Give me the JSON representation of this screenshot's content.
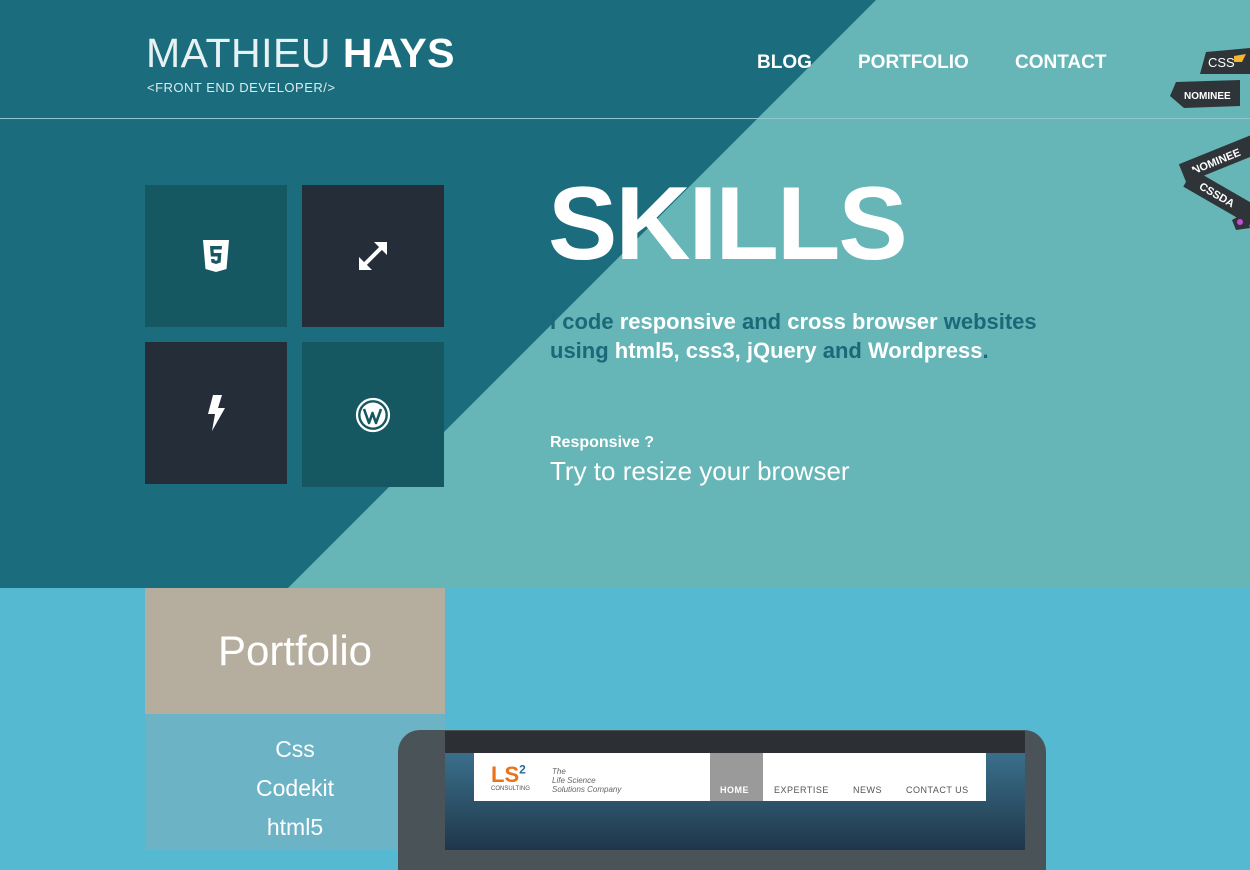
{
  "header": {
    "name_light": "MATHIEU ",
    "name_bold": "HAYS",
    "subtitle": "<FRONT END DEVELOPER/>",
    "nav": [
      "BLOG",
      "PORTFOLIO",
      "CONTACT"
    ]
  },
  "badges": {
    "css_text": "CSS",
    "css_nominee": "NOMINEE",
    "cssda_nominee": "NOMINEE",
    "cssda_text": "CSSDA"
  },
  "skills": {
    "title": "SKILLS",
    "line1": {
      "p1": "I code ",
      "h1": "responsive",
      "p2": " and ",
      "h2": "cross browser",
      "p3": " websites"
    },
    "line2": {
      "p1": "using ",
      "h1": "html5",
      "p2": ", ",
      "h2": "css3",
      "p3": ", ",
      "h3": "jQuery",
      "p4": " and ",
      "h4": "Wordpress",
      "p5": "."
    },
    "responsive_question": "Responsive ?",
    "responsive_try": "Try to resize your browser",
    "tiles": [
      {
        "icon": "html5-icon"
      },
      {
        "icon": "expand-arrows-icon"
      },
      {
        "icon": "lightning-icon"
      },
      {
        "icon": "wordpress-icon"
      }
    ]
  },
  "portfolio": {
    "heading": "Portfolio",
    "items": [
      "Css",
      "Codekit",
      "html5"
    ]
  },
  "preview_site": {
    "logo": "LS",
    "logo_sup": "2",
    "logo_sub": "CONSULTING",
    "tagline_1": "The",
    "tagline_2": "Life Science",
    "tagline_3": "Solutions Company",
    "nav": [
      "HOME",
      "EXPERTISE",
      "NEWS",
      "CONTACT US"
    ]
  },
  "colors": {
    "dark_teal": "#1b6d7d",
    "light_teal": "#66b5b7",
    "sky": "#55b9d2",
    "tile_teal": "#155861",
    "tile_navy": "#242d38",
    "portfolio_head": "#b5ae9e",
    "portfolio_list": "#6cb3c5"
  }
}
